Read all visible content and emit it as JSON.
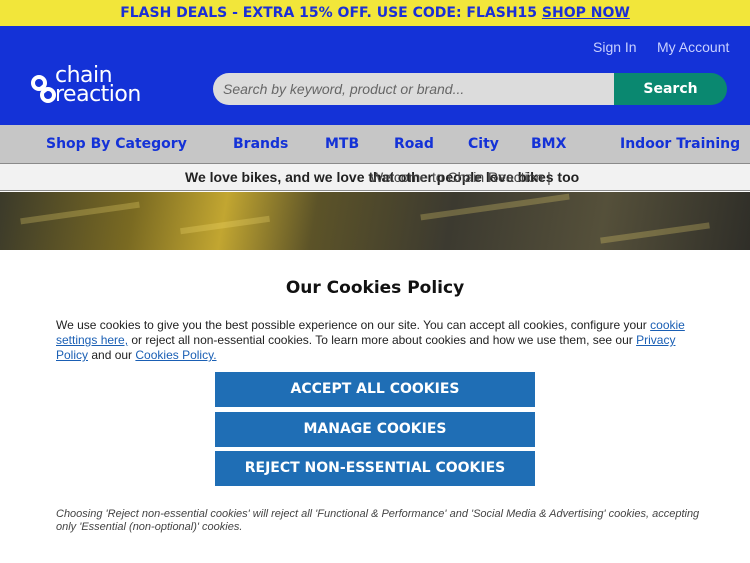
{
  "promo": {
    "text": "FLASH DEALS - EXTRA 15% OFF.  USE CODE: FLASH15 ",
    "link": "SHOP NOW"
  },
  "header": {
    "sign_in": "Sign In",
    "my_account": "My Account",
    "logo_line1": "chain",
    "logo_line2": "reaction",
    "search_placeholder": "Search by keyword, product or brand...",
    "search_button": "Search"
  },
  "nav": {
    "items": [
      "Shop By Category",
      "Brands",
      "MTB",
      "Road",
      "City",
      "BMX",
      "Indoor Training"
    ]
  },
  "welcome": {
    "prefix": "Welcome to Chain Reaction | ",
    "bold": "We love bikes, and we love that other people love bikes too"
  },
  "cookies": {
    "title": "Our Cookies Policy",
    "text_1": "We use cookies to give you the best possible experience on our site. You can accept all cookies, configure your ",
    "link_settings": "cookie settings here,",
    "text_2": " or reject all non-essential cookies. To learn more about cookies and how we use them, see our ",
    "link_privacy": "Privacy Policy",
    "text_3": " and our ",
    "link_cookies": "Cookies Policy.",
    "accept_all": "ACCEPT ALL COOKIES",
    "manage": "MANAGE COOKIES",
    "reject": "REJECT NON-ESSENTIAL COOKIES",
    "note": "Choosing 'Reject non-essential cookies' will reject all 'Functional & Performance' and 'Social Media & Advertising' cookies, accepting only 'Essential (non-optional)' cookies."
  },
  "colors": {
    "promo_bg": "#f2e63a",
    "brand_blue": "#1432d7",
    "search_green": "#0a8870",
    "button_blue": "#1f6eb5"
  }
}
